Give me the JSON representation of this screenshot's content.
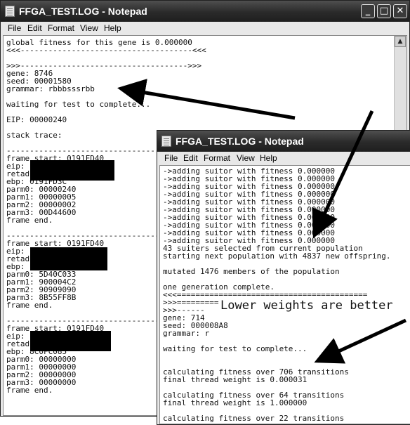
{
  "back_window": {
    "title": "FFGA_TEST.LOG - Notepad",
    "menu": [
      "File",
      "Edit",
      "Format",
      "View",
      "Help"
    ],
    "lines": [
      "global fitness for this gene is 0.000000",
      "<<<-------------------------------------<<<",
      "",
      ">>>------------------------------------>>>",
      "gene: 8746",
      "seed: 00001580",
      "grammar: rbbbsssrbb",
      "",
      "waiting for test to complete...",
      "",
      "EIP: 00000240",
      "",
      "stack trace:",
      "",
      "--------------------------------------------",
      "frame start: 0191FD40",
      "eip:",
      "retad",
      "ebp: 0191FD3C",
      "parm0: 00000240",
      "parm1: 00000005",
      "parm2: 00000002",
      "parm3: 00D44600",
      "frame end.",
      "",
      "--------------------------------------------",
      "frame start: 0191FD40",
      "eip:",
      "retad",
      "ebp:",
      "parm0: 5D40C033",
      "parm1: 900004C2",
      "parm2: 90909090",
      "parm3: 8B55FF8B",
      "frame end.",
      "",
      "--------------------------------------------",
      "frame start: 0191FD40",
      "eip:",
      "retad",
      "ebp: 8C0FC085",
      "parm0: 00000000",
      "parm1: 00000000",
      "parm2: 00000000",
      "parm3: 00000000",
      "frame end."
    ]
  },
  "front_window": {
    "title": "FFGA_TEST.LOG - Notepad",
    "menu": [
      "File",
      "Edit",
      "Format",
      "View",
      "Help"
    ],
    "lines": [
      "->adding suitor with fitness 0.000000",
      "->adding suitor with fitness 0.000000",
      "->adding suitor with fitness 0.000000",
      "->adding suitor with fitness 0.000000",
      "->adding suitor with fitness 0.000000",
      "->adding suitor with fitness 0.000000",
      "->adding suitor with fitness 0.000000",
      "->adding suitor with fitness 0.000000",
      "->adding suitor with fitness 0.000000",
      "->adding suitor with fitness 0.000000",
      "43 suiters selected from current population",
      "starting next population with 4837 new offspring.",
      "",
      "mutated 1476 members of the population",
      "",
      "one generation complete.",
      "<<<=========================================",
      ">>>=========================================",
      ">>>------",
      "gene: 714",
      "seed: 000008A8",
      "grammar: r",
      "",
      "waiting for test to complete...",
      "",
      "",
      "calculating fitness over 706 transitions",
      "final thread weight is 0.000031",
      "",
      "calculating fitness over 64 transitions",
      "final thread weight is 1.000000",
      "",
      "calculating fitness over 22 transitions"
    ]
  },
  "annotation": "Lower weights are better"
}
